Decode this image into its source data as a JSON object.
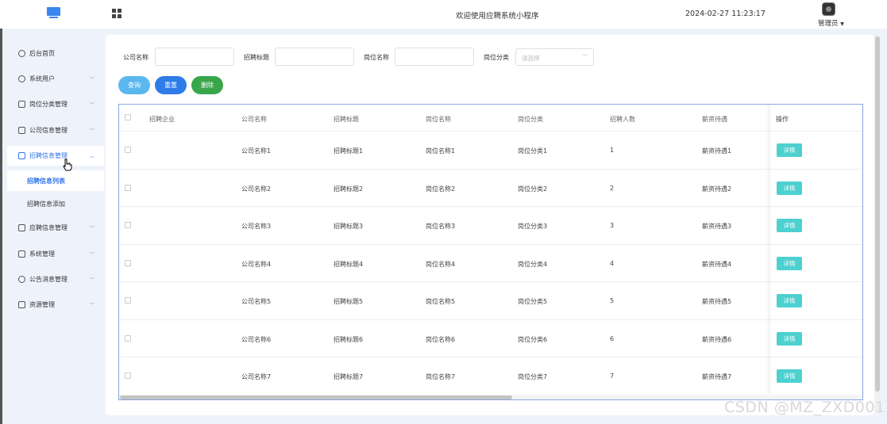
{
  "header": {
    "welcome": "欢迎使用应聘系统小程序",
    "datetime": "2024-02-27 11:23:17",
    "user": "管理员"
  },
  "sidebar": {
    "items": [
      {
        "label": "后台首页",
        "icon": "clock-icon"
      },
      {
        "label": "系统用户",
        "icon": "user-icon"
      },
      {
        "label": "岗位分类管理",
        "icon": "folder-icon"
      },
      {
        "label": "公司信息管理",
        "icon": "folder-icon"
      },
      {
        "label": "招聘信息管理",
        "icon": "folder-icon"
      },
      {
        "label": "应聘信息管理",
        "icon": "folder-icon"
      },
      {
        "label": "系统管理",
        "icon": "folder-icon"
      },
      {
        "label": "公告消息管理",
        "icon": "megaphone-icon"
      },
      {
        "label": "资源管理",
        "icon": "box-icon"
      }
    ],
    "sub_items": [
      "招聘信息列表",
      "招聘信息添加"
    ]
  },
  "filters": {
    "company_label": "公司名称",
    "title_label": "招聘标题",
    "position_label": "岗位名称",
    "category_label": "岗位分类",
    "category_placeholder": "请选择"
  },
  "buttons": {
    "search": "查询",
    "reset": "重置",
    "delete": "删除"
  },
  "table": {
    "headers": [
      "招聘企业",
      "公司名称",
      "招聘标题",
      "岗位名称",
      "岗位分类",
      "招聘人数",
      "薪资待遇",
      "操作"
    ],
    "detail_label": "详情",
    "rows": [
      [
        "",
        "公司名称1",
        "招聘标题1",
        "岗位名称1",
        "岗位分类1",
        "1",
        "薪资待遇1"
      ],
      [
        "",
        "公司名称2",
        "招聘标题2",
        "岗位名称2",
        "岗位分类2",
        "2",
        "薪资待遇2"
      ],
      [
        "",
        "公司名称3",
        "招聘标题3",
        "岗位名称3",
        "岗位分类3",
        "3",
        "薪资待遇3"
      ],
      [
        "",
        "公司名称4",
        "招聘标题4",
        "岗位名称4",
        "岗位分类4",
        "4",
        "薪资待遇4"
      ],
      [
        "",
        "公司名称5",
        "招聘标题5",
        "岗位名称5",
        "岗位分类5",
        "5",
        "薪资待遇5"
      ],
      [
        "",
        "公司名称6",
        "招聘标题6",
        "岗位名称6",
        "岗位分类6",
        "6",
        "薪资待遇6"
      ],
      [
        "",
        "公司名称7",
        "招聘标题7",
        "岗位名称7",
        "岗位分类7",
        "7",
        "薪资待遇7"
      ]
    ]
  },
  "watermark": "CSDN @MZ_ZXD001"
}
